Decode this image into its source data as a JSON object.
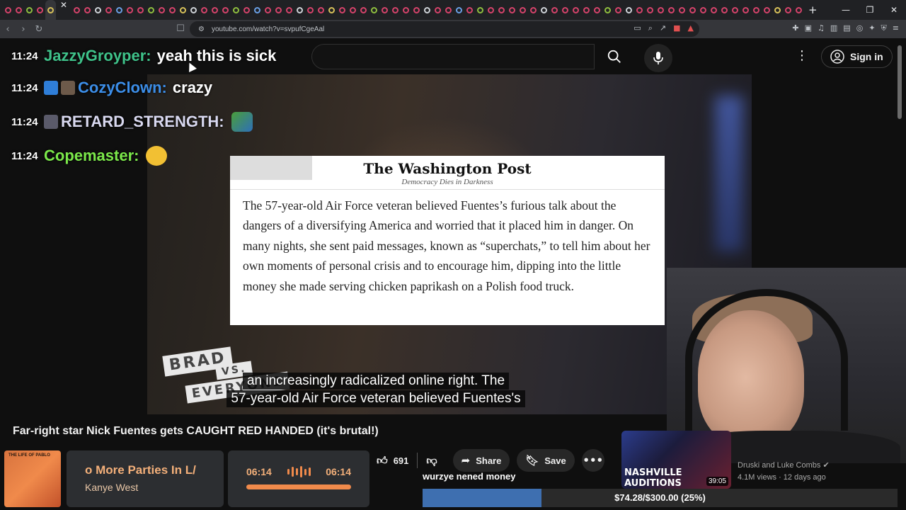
{
  "browser": {
    "url": "youtube.com/watch?v=svpufCgeAal"
  },
  "header": {
    "signin_label": "Sign in"
  },
  "chat": [
    {
      "time": "11:24",
      "user": "JazzyGroyper:",
      "message": "yeah this is sick",
      "user_color": "#3fc28a"
    },
    {
      "time": "11:24",
      "user": "CozyClown:",
      "message": "crazy",
      "user_color": "#3c8ee8"
    },
    {
      "time": "11:24",
      "user": "RETARD_STRENGTH:",
      "message": "",
      "user_color": "#d9d9f0"
    },
    {
      "time": "11:24",
      "user": "Copemaster:",
      "message": "",
      "user_color": "#7be84a"
    }
  ],
  "article": {
    "masthead": "The Washington Post",
    "tagline": "Democracy Dies in Darkness",
    "body": "The 57-year-old Air Force veteran believed Fuentes’s furious talk about the dangers of a diversifying America and worried that it placed him in danger. On many nights, she sent paid messages, known as “superchats,” to tell him about her own moments of personal crisis and to encourage him, dipping into the little money she made serving chicken paprikash on a Polish food truck."
  },
  "overlay_logo": {
    "line1": "BRAD",
    "line2": "VS.",
    "line3": "EVERYONE"
  },
  "captions": {
    "line1": "an increasingly radicalized online right. The",
    "line2": "57-year-old Air Force veteran believed Fuentes's"
  },
  "video": {
    "title": "Far-right star Nick Fuentes gets CAUGHT RED HANDED (it's brutal!)",
    "likes": "691",
    "share_label": "Share",
    "save_label": "Save"
  },
  "music": {
    "album_text": "THE LIFE OF PABLO",
    "song_title": "o More Parties In L/",
    "artist": "Kanye West",
    "current_time": "06:14",
    "total_time": "06:14",
    "progress": 1.0
  },
  "donation": {
    "latest_name": "wurzye nened money",
    "goal_text": "$74.28/$300.00 (25%)",
    "progress": 0.25
  },
  "recommended": {
    "thumb_text": "NASHVILLE AUDITIONS",
    "duration": "39:05",
    "channel": "Druski and Luke Combs",
    "meta": "4.1M views · 12 days ago"
  },
  "colors": {
    "accent_orange": "#f08a4b",
    "donation_blue": "#3e6fb0"
  }
}
